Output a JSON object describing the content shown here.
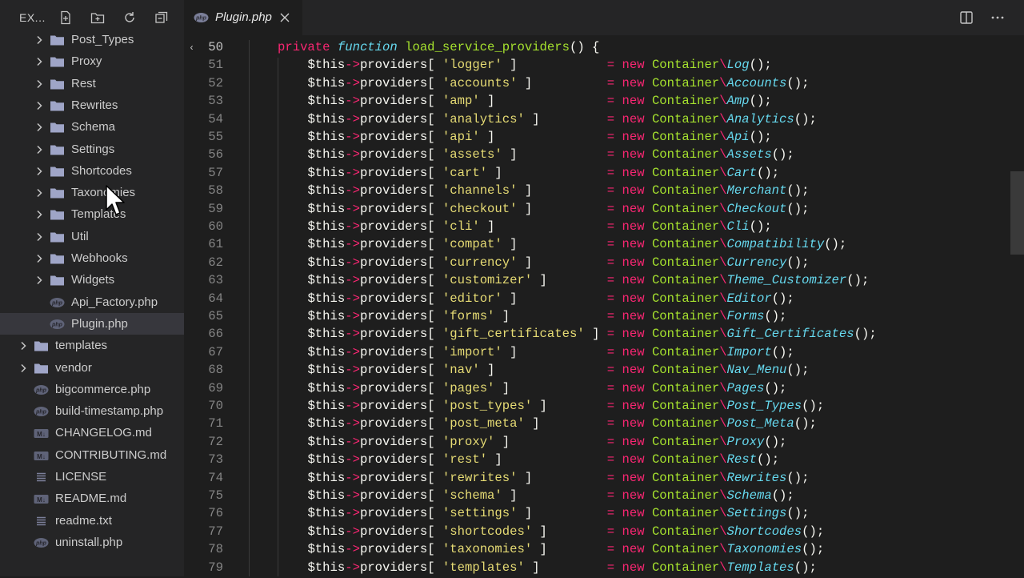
{
  "sidebar": {
    "title": "EX...",
    "actions": [
      {
        "icon": "new-file-icon"
      },
      {
        "icon": "new-folder-icon"
      },
      {
        "icon": "refresh-icon"
      },
      {
        "icon": "collapse-all-icon"
      }
    ],
    "items": [
      {
        "label": "Post_Types",
        "kind": "folder",
        "depth": 2
      },
      {
        "label": "Proxy",
        "kind": "folder",
        "depth": 2
      },
      {
        "label": "Rest",
        "kind": "folder",
        "depth": 2
      },
      {
        "label": "Rewrites",
        "kind": "folder",
        "depth": 2
      },
      {
        "label": "Schema",
        "kind": "folder",
        "depth": 2
      },
      {
        "label": "Settings",
        "kind": "folder",
        "depth": 2
      },
      {
        "label": "Shortcodes",
        "kind": "folder",
        "depth": 2
      },
      {
        "label": "Taxonomies",
        "kind": "folder",
        "depth": 2
      },
      {
        "label": "Templates",
        "kind": "folder",
        "depth": 2
      },
      {
        "label": "Util",
        "kind": "folder",
        "depth": 2
      },
      {
        "label": "Webhooks",
        "kind": "folder",
        "depth": 2
      },
      {
        "label": "Widgets",
        "kind": "folder",
        "depth": 2
      },
      {
        "label": "Api_Factory.php",
        "kind": "php",
        "depth": 2
      },
      {
        "label": "Plugin.php",
        "kind": "php",
        "depth": 2,
        "selected": true
      },
      {
        "label": "templates",
        "kind": "folder",
        "depth": 1
      },
      {
        "label": "vendor",
        "kind": "folder",
        "depth": 1
      },
      {
        "label": "bigcommerce.php",
        "kind": "php",
        "depth": 1
      },
      {
        "label": "build-timestamp.php",
        "kind": "php",
        "depth": 1
      },
      {
        "label": "CHANGELOG.md",
        "kind": "md",
        "depth": 1
      },
      {
        "label": "CONTRIBUTING.md",
        "kind": "md",
        "depth": 1
      },
      {
        "label": "LICENSE",
        "kind": "text",
        "depth": 1
      },
      {
        "label": "README.md",
        "kind": "md",
        "depth": 1
      },
      {
        "label": "readme.txt",
        "kind": "text",
        "depth": 1
      },
      {
        "label": "uninstall.php",
        "kind": "php",
        "depth": 1
      }
    ]
  },
  "editor": {
    "tab": {
      "label": "Plugin.php",
      "icon": "php-file-icon"
    },
    "actions": [
      {
        "icon": "split-editor-icon"
      },
      {
        "icon": "more-actions-icon"
      }
    ],
    "current_line": 50,
    "lines": [
      {
        "n": "50",
        "fold": "‹",
        "tokens": [
          [
            "kw",
            "private "
          ],
          [
            "fn",
            "function "
          ],
          [
            "name",
            "load_service_providers"
          ],
          [
            "p",
            "() {"
          ]
        ]
      },
      {
        "n": "51",
        "key": "logger",
        "cls": "Log"
      },
      {
        "n": "52",
        "key": "accounts",
        "cls": "Accounts"
      },
      {
        "n": "53",
        "key": "amp",
        "cls": "Amp"
      },
      {
        "n": "54",
        "key": "analytics",
        "cls": "Analytics"
      },
      {
        "n": "55",
        "key": "api",
        "cls": "Api"
      },
      {
        "n": "56",
        "key": "assets",
        "cls": "Assets"
      },
      {
        "n": "57",
        "key": "cart",
        "cls": "Cart"
      },
      {
        "n": "58",
        "key": "channels",
        "cls": "Merchant"
      },
      {
        "n": "59",
        "key": "checkout",
        "cls": "Checkout"
      },
      {
        "n": "60",
        "key": "cli",
        "cls": "Cli"
      },
      {
        "n": "61",
        "key": "compat",
        "cls": "Compatibility"
      },
      {
        "n": "62",
        "key": "currency",
        "cls": "Currency"
      },
      {
        "n": "63",
        "key": "customizer",
        "cls": "Theme_Customizer"
      },
      {
        "n": "64",
        "key": "editor",
        "cls": "Editor"
      },
      {
        "n": "65",
        "key": "forms",
        "cls": "Forms"
      },
      {
        "n": "66",
        "key": "gift_certificates",
        "cls": "Gift_Certificates"
      },
      {
        "n": "67",
        "key": "import",
        "cls": "Import"
      },
      {
        "n": "68",
        "key": "nav",
        "cls": "Nav_Menu"
      },
      {
        "n": "69",
        "key": "pages",
        "cls": "Pages"
      },
      {
        "n": "70",
        "key": "post_types",
        "cls": "Post_Types"
      },
      {
        "n": "71",
        "key": "post_meta",
        "cls": "Post_Meta"
      },
      {
        "n": "72",
        "key": "proxy",
        "cls": "Proxy"
      },
      {
        "n": "73",
        "key": "rest",
        "cls": "Rest"
      },
      {
        "n": "74",
        "key": "rewrites",
        "cls": "Rewrites"
      },
      {
        "n": "75",
        "key": "schema",
        "cls": "Schema"
      },
      {
        "n": "76",
        "key": "settings",
        "cls": "Settings"
      },
      {
        "n": "77",
        "key": "shortcodes",
        "cls": "Shortcodes"
      },
      {
        "n": "78",
        "key": "taxonomies",
        "cls": "Taxonomies"
      },
      {
        "n": "79",
        "key": "templates",
        "cls": "Templates"
      }
    ]
  },
  "colors": {
    "keyword": "#f92672",
    "function": "#66d9ef",
    "string": "#e6db74",
    "name": "#a6e22e",
    "text": "#f8f8f2",
    "background": "#1e1e1e",
    "sidebar": "#252526"
  }
}
